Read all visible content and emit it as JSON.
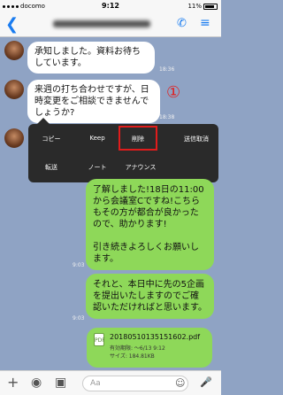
{
  "status": {
    "carrier": "docomo",
    "time": "9:12",
    "battery": "11%"
  },
  "nav": {
    "back_glyph": "❮",
    "phone_glyph": "✆",
    "menu_glyph": "≡"
  },
  "messages": [
    {
      "text": "承知しました。資料お待ちしています。",
      "time": "18:36"
    },
    {
      "text": "来週の打ち合わせですが、日時変更をご相談できませんでしょうか?",
      "time": "18:38"
    },
    {
      "text": "了解しました!18日の11:00から会議室Cですね!こちらもその方が都合が良かったので、助かります!\n\n引き続きよろしくお願いします。",
      "time": "9:03"
    },
    {
      "text": "それと、本日中に先の5企画を提出いたしますのでご確認いただければと思います。",
      "time": "9:03"
    }
  ],
  "annotation": "①",
  "context_menu": {
    "copy": "コピー",
    "keep": "Keep",
    "delete": "削除",
    "unsend": "送信取消",
    "forward": "転送",
    "note": "ノート",
    "announce": "アナウンス"
  },
  "file": {
    "icon_label": "PDF",
    "name": "20180510135151602.pdf",
    "expiry": "有効期限: 〜6/13 9:12",
    "size": "サイズ: 184.81KB"
  },
  "input_bar": {
    "add_glyph": "+",
    "camera_glyph": "◉",
    "image_glyph": "▣",
    "placeholder": "Aa",
    "emoji_glyph": "☺",
    "mic_glyph": "🎤"
  },
  "colors": {
    "background": "#8fa3c4",
    "incoming_bubble": "#ffffff",
    "outgoing_bubble": "#8ed859",
    "menu_bg": "#2a2a2a",
    "highlight": "#e01c1c",
    "accent": "#1a7cf0"
  }
}
